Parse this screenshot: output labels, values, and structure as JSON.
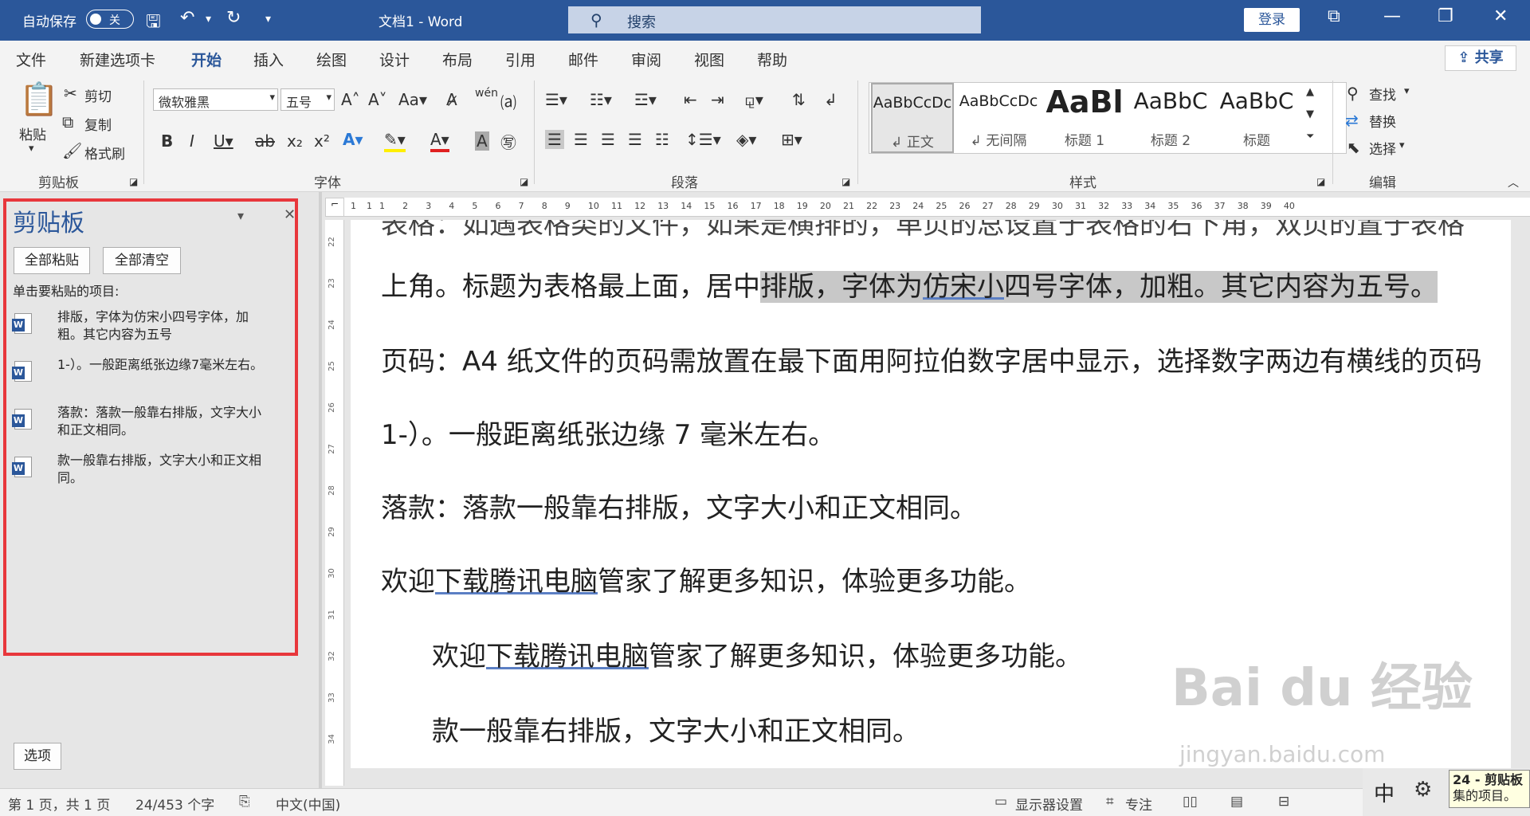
{
  "titlebar": {
    "autosave_label": "自动保存",
    "autosave_state": "关",
    "doc_title": "文档1  -  Word",
    "search_placeholder": "搜索",
    "login": "登录"
  },
  "tabs": [
    "文件",
    "新建选项卡",
    "开始",
    "插入",
    "绘图",
    "设计",
    "布局",
    "引用",
    "邮件",
    "审阅",
    "视图",
    "帮助"
  ],
  "share": "共享",
  "ribbon": {
    "clipboard": {
      "paste": "粘贴",
      "cut": "剪切",
      "copy": "复制",
      "format_painter": "格式刷",
      "label": "剪贴板"
    },
    "font": {
      "family": "微软雅黑",
      "size": "五号",
      "label": "字体"
    },
    "paragraph": {
      "label": "段落"
    },
    "styles": {
      "items": [
        {
          "preview": "AaBbCcDc",
          "name": "↲ 正文"
        },
        {
          "preview": "AaBbCcDc",
          "name": "↲ 无间隔"
        },
        {
          "preview": "AaBl",
          "name": "标题 1"
        },
        {
          "preview": "AaBbC",
          "name": "标题 2"
        },
        {
          "preview": "AaBbC",
          "name": "标题"
        }
      ],
      "label": "样式"
    },
    "editing": {
      "find": "查找",
      "replace": "替换",
      "select": "选择",
      "label": "编辑"
    }
  },
  "pane": {
    "title": "剪贴板",
    "paste_all": "全部粘贴",
    "clear_all": "全部清空",
    "hint": "单击要粘贴的项目:",
    "items": [
      "排版，字体为仿宋小四号字体，加粗。其它内容为五号",
      "1-）。一般距离纸张边缘7毫米左右。",
      "落款：落款一般靠右排版，文字大小和正文相同。",
      "款一般靠右排版，文字大小和正文相同。"
    ],
    "options": "选项"
  },
  "ruler": [
    "1",
    "1",
    "1",
    "2",
    "3",
    "4",
    "5",
    "6",
    "7",
    "8",
    "9",
    "10",
    "11",
    "12",
    "13",
    "14",
    "15",
    "16",
    "17",
    "18",
    "19",
    "20",
    "21",
    "22",
    "23",
    "24",
    "25",
    "26",
    "27",
    "28",
    "29",
    "30",
    "31",
    "32",
    "33",
    "34",
    "35",
    "36",
    "37",
    "38",
    "39",
    "40"
  ],
  "vruler": [
    "22",
    "23",
    "24",
    "25",
    "26",
    "27",
    "28",
    "29",
    "30",
    "31",
    "32",
    "33",
    "34"
  ],
  "document": {
    "line0": "表格：如遇表格类的文件，如果是横排的，单页的总设置于表格的右下角，双页的置于表格",
    "line1a": "上角。标题为表格最上面，居中",
    "line1b": "排版，字体为",
    "line1c": "仿宋小",
    "line1d": "四号字体，加粗。其它内容为五号。",
    "line2": "页码：A4 纸文件的页码需放置在最下面用阿拉伯数字居中显示，选择数字两边有横线的页码",
    "line3": "1-）。一般距离纸张边缘 7 毫米左右。",
    "line4": "落款：落款一般靠右排版，文字大小和正文相同。",
    "line5a": "欢迎",
    "line5b": "下载腾讯电脑",
    "line5c": "管家了解更多知识，体验更多功能。",
    "line6a": "欢迎",
    "line6b": "下载腾讯电脑",
    "line6c": "管家了解更多知识，体验更多功能。",
    "line7": "款一般靠右排版，文字大小和正文相同。"
  },
  "status": {
    "page": "第 1 页，共 1 页",
    "words": "24/453 个字",
    "lang": "中文(中国)",
    "display": "显示器设置",
    "focus": "专注"
  },
  "watermark": "Bai du 经验",
  "watermark_url": "jingyan.baidu.com",
  "taskbar": {
    "ime": "中"
  },
  "tooltip": {
    "line1": "24 - 剪贴板",
    "line2": "集的项目。"
  }
}
